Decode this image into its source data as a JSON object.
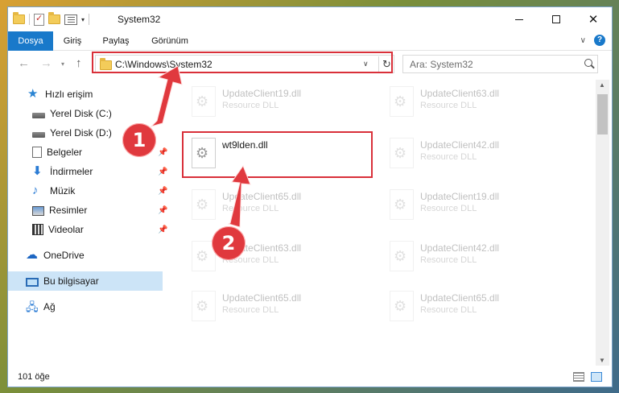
{
  "window": {
    "title": "System32",
    "minimize_glyph": "",
    "close_glyph": "✕"
  },
  "ribbon": {
    "tabs": [
      "Dosya",
      "Giriş",
      "Paylaş",
      "Görünüm"
    ]
  },
  "navigation": {
    "address": "C:\\Windows\\System32",
    "search_placeholder": "Ara: System32",
    "refresh_glyph": "↻"
  },
  "sidebar": {
    "items": [
      {
        "label": "Hızlı erişim",
        "icon": "star-icon"
      },
      {
        "label": "Yerel Disk (C:)",
        "icon": "disk-icon"
      },
      {
        "label": "Yerel Disk (D:)",
        "icon": "disk-icon"
      },
      {
        "label": "Belgeler",
        "icon": "documents-icon"
      },
      {
        "label": "İndirmeler",
        "icon": "downloads-icon"
      },
      {
        "label": "Müzik",
        "icon": "music-icon"
      },
      {
        "label": "Resimler",
        "icon": "pictures-icon"
      },
      {
        "label": "Videolar",
        "icon": "videos-icon"
      },
      {
        "label": "OneDrive",
        "icon": "cloud-icon"
      },
      {
        "label": "Bu bilgisayar",
        "icon": "computer-icon"
      },
      {
        "label": "Ağ",
        "icon": "network-icon"
      }
    ]
  },
  "files": [
    {
      "name": "UpdateClient19.dll",
      "type": "Resource DLL"
    },
    {
      "name": "UpdateClient63.dll",
      "type": "Resource DLL"
    },
    {
      "name": "wt9lden.dll",
      "type": ""
    },
    {
      "name": "UpdateClient42.dll",
      "type": "Resource DLL"
    },
    {
      "name": "UpdateClient65.dll",
      "type": "Resource DLL"
    },
    {
      "name": "UpdateClient19.dll",
      "type": "Resource DLL"
    },
    {
      "name": "UpdateClient63.dll",
      "type": "Resource DLL"
    },
    {
      "name": "UpdateClient42.dll",
      "type": "Resource DLL"
    },
    {
      "name": "UpdateClient65.dll",
      "type": "Resource DLL"
    },
    {
      "name": "UpdateClient65.dll",
      "type": "Resource DLL"
    }
  ],
  "status": {
    "item_count": "101 öğe"
  },
  "annotations": {
    "step1": "1",
    "step2": "2",
    "color": "#d9303a"
  }
}
